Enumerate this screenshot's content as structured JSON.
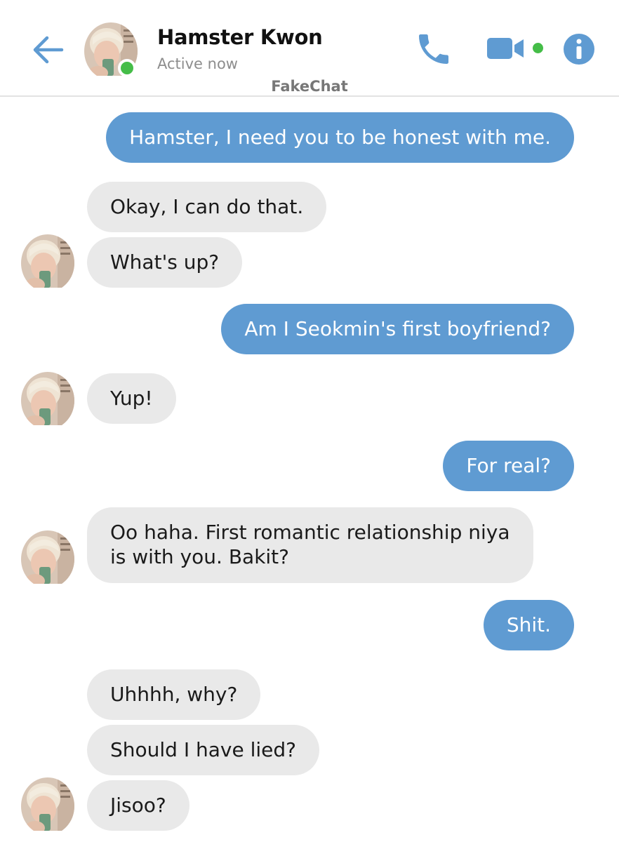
{
  "header": {
    "back_icon": "arrow-left-icon",
    "contact_name": "Hamster Kwon",
    "contact_status": "Active now",
    "app_label": "FakeChat",
    "phone_icon": "phone-icon",
    "video_icon": "video-camera-icon",
    "info_icon": "info-icon"
  },
  "colors": {
    "accent": "#5f9bd2",
    "online": "#45bd48",
    "their_bubble": "#e9e9e9"
  },
  "messages": [
    {
      "sender": "me",
      "text": "Hamster, I need you to be honest with me."
    },
    {
      "sender": "them",
      "text": "Okay, I can do that."
    },
    {
      "sender": "them",
      "text": "What's up?"
    },
    {
      "sender": "me",
      "text": "Am I Seokmin's first boyfriend?"
    },
    {
      "sender": "them",
      "text": "Yup!"
    },
    {
      "sender": "me",
      "text": "For real?"
    },
    {
      "sender": "them",
      "lines": [
        "Oo haha. First romantic relationship niya",
        "is with you. Bakit?"
      ]
    },
    {
      "sender": "me",
      "text": "Shit."
    },
    {
      "sender": "them",
      "text": "Uhhhh, why?"
    },
    {
      "sender": "them",
      "text": "Should I have lied?"
    },
    {
      "sender": "them",
      "text": "Jisoo?"
    }
  ]
}
